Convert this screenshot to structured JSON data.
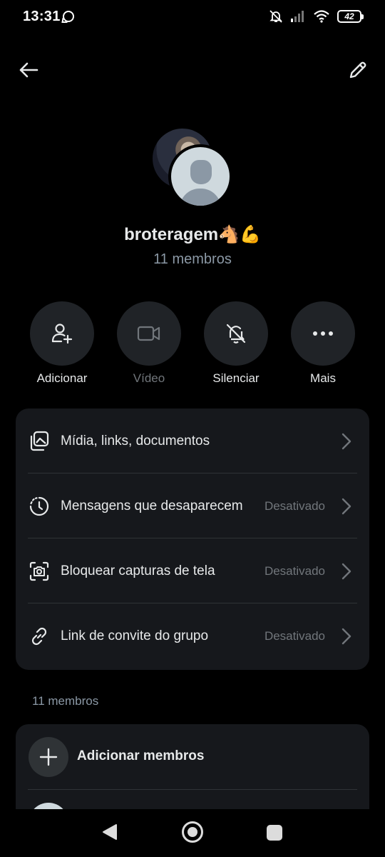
{
  "status_bar": {
    "time": "13:31",
    "battery": "42",
    "icons": [
      "chat-bubble-icon",
      "bell-off-icon",
      "signal-icon",
      "wifi-icon",
      "battery-icon"
    ]
  },
  "nav": {
    "back_icon": "arrow-left-icon",
    "edit_icon": "pencil-icon"
  },
  "group": {
    "name": "broteragem🐴💪",
    "members": "11 membros"
  },
  "actions": [
    {
      "label": "Adicionar",
      "icon": "add-user-icon",
      "enabled": true
    },
    {
      "label": "Vídeo",
      "icon": "video-camera-icon",
      "enabled": false
    },
    {
      "label": "Silenciar",
      "icon": "bell-off-icon",
      "enabled": true
    },
    {
      "label": "Mais",
      "icon": "more-dots-icon",
      "enabled": true
    }
  ],
  "settings": [
    {
      "label": "Mídia, links, documentos",
      "value": "",
      "icon": "media-stack-icon"
    },
    {
      "label": "Mensagens que desaparecem",
      "value": "Desativado",
      "icon": "timer-icon"
    },
    {
      "label": "Bloquear capturas de tela",
      "value": "Desativado",
      "icon": "screenshot-icon"
    },
    {
      "label": "Link de convite do grupo",
      "value": "Desativado",
      "icon": "link-icon"
    }
  ],
  "members_section": {
    "header": "11 membros",
    "add_label": "Adicionar membros"
  },
  "colors": {
    "background": "#000000",
    "card": "#16181c",
    "action_circle": "#202327",
    "text_primary": "#e7e9ea",
    "text_secondary": "#71767b"
  }
}
